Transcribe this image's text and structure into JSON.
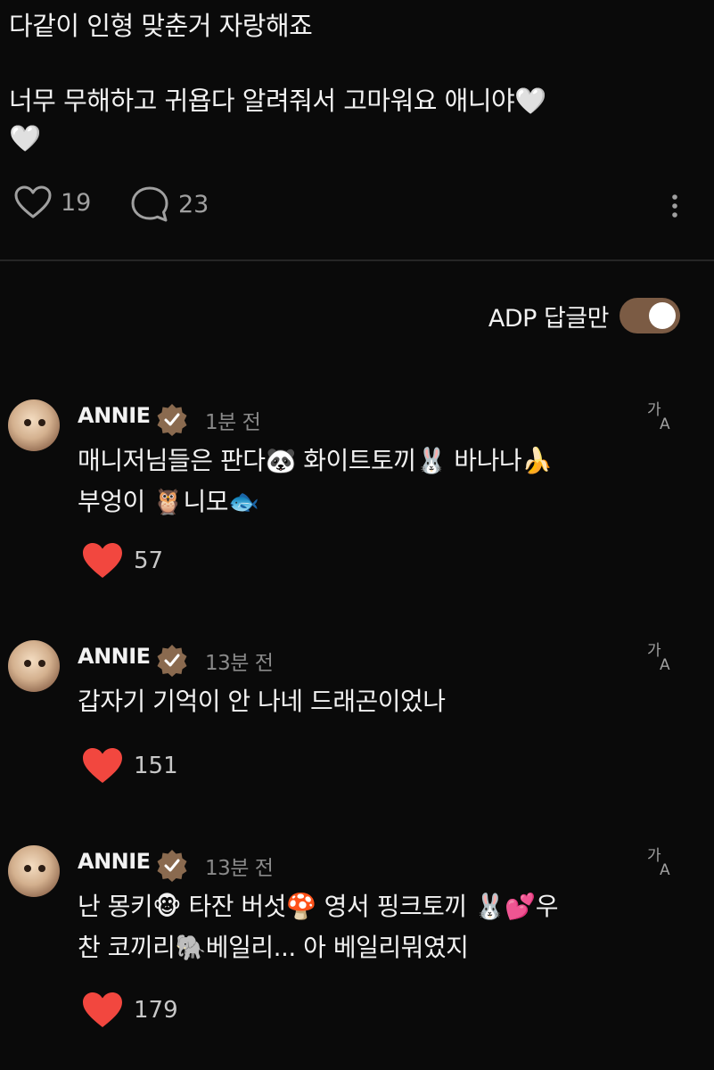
{
  "post": {
    "text": "다같이 인형 맞춘거 자랑해죠\n\n너무 무해하고 귀욥다 알려줘서 고마워요 애니야🤍\n🤍",
    "like_count": "19",
    "comment_count": "23"
  },
  "filter": {
    "label": "ADP 답글만",
    "toggle_on": true
  },
  "colors": {
    "background": "#0a0a0a",
    "toggle": "#7b5b44",
    "like_red": "#f2473f",
    "verified_badge": "#8a6a4f"
  },
  "comments": [
    {
      "username": "ANNIE",
      "time": "1분 전",
      "text": "매니저님들은 판다🐼 화이트토끼🐰 바나나🍌\n부엉이 🦉니모🐟",
      "likes": "57"
    },
    {
      "username": "ANNIE",
      "time": "13분 전",
      "text": "갑자기 기억이 안 나네 드래곤이었나",
      "likes": "151"
    },
    {
      "username": "ANNIE",
      "time": "13분 전",
      "text": "난 몽키🐵 타잔 버섯🍄 영서 핑크토끼 🐰💕우\n찬 코끼리🐘베일리... 아 베일리뭐였지",
      "likes": "179"
    }
  ],
  "icons": {
    "like": "heart-outline-icon",
    "comment": "comment-bubble-icon",
    "more": "more-vertical-icon",
    "verified": "verified-badge-icon",
    "translate": "translate-icon",
    "liked": "heart-filled-icon"
  }
}
